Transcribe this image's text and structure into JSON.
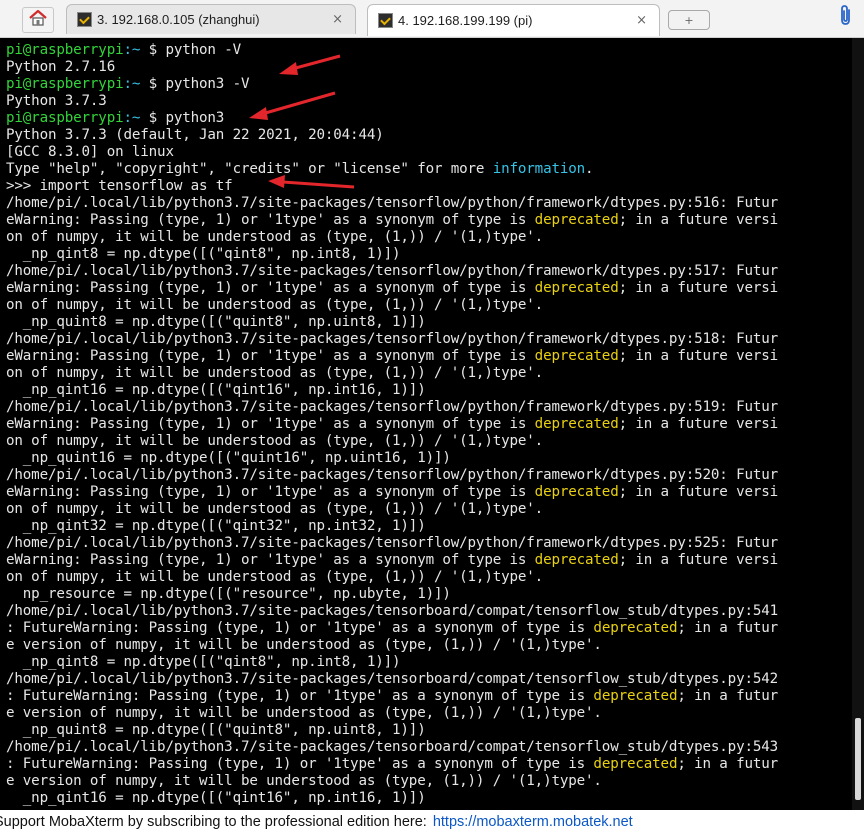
{
  "tabs": [
    {
      "label": "3. 192.168.0.105 (zhanghui)",
      "close": "×",
      "icon": "terminal-icon"
    },
    {
      "label": "4. 192.168.199.199 (pi)",
      "close": "×",
      "icon": "terminal-icon"
    }
  ],
  "newtab_label": "+",
  "icons": {
    "home": "home-icon",
    "attach": "paperclip-icon"
  },
  "colors": {
    "prompt": "#32d43a",
    "path_sep": "#36c3e6",
    "highlight": "#e8d10e",
    "text": "#e6e6e6",
    "background": "#000000",
    "arrow": "#e3262b"
  },
  "terminal_lines": [
    [
      {
        "t": "pi@raspberrypi",
        "c": "g"
      },
      {
        "t": ":~ ",
        "c": "c"
      },
      {
        "t": "$ python -V"
      }
    ],
    [
      {
        "t": "Python 2.7.16"
      }
    ],
    [
      {
        "t": "pi@raspberrypi",
        "c": "g"
      },
      {
        "t": ":~ ",
        "c": "c"
      },
      {
        "t": "$ python3 -V"
      }
    ],
    [
      {
        "t": "Python 3.7.3"
      }
    ],
    [
      {
        "t": "pi@raspberrypi",
        "c": "g"
      },
      {
        "t": ":~ ",
        "c": "c"
      },
      {
        "t": "$ python3"
      }
    ],
    [
      {
        "t": "Python 3.7.3 (default, Jan 22 2021, 20:04:44)"
      }
    ],
    [
      {
        "t": "[GCC 8.3.0] on linux"
      }
    ],
    [
      {
        "t": "Type \"help\", \"copyright\", \"credits\" or \"license\" for more "
      },
      {
        "t": "information",
        "c": "c"
      },
      {
        "t": "."
      }
    ],
    [
      {
        "t": ">>> import tensorflow as tf"
      }
    ],
    [
      {
        "t": "/home/pi/.local/lib/python3.7/site-packages/tensorflow/python/framework/dtypes.py:516: Futur"
      }
    ],
    [
      {
        "t": "eWarning: Passing (type, 1) or '1type' as a synonym of type is "
      },
      {
        "t": "deprecated",
        "c": "y"
      },
      {
        "t": "; in a future versi"
      }
    ],
    [
      {
        "t": "on of numpy, it will be understood as (type, (1,)) / '(1,)type'."
      }
    ],
    [
      {
        "t": "  _np_qint8 = np.dtype([(\"qint8\", np.int8, 1)])"
      }
    ],
    [
      {
        "t": "/home/pi/.local/lib/python3.7/site-packages/tensorflow/python/framework/dtypes.py:517: Futur"
      }
    ],
    [
      {
        "t": "eWarning: Passing (type, 1) or '1type' as a synonym of type is "
      },
      {
        "t": "deprecated",
        "c": "y"
      },
      {
        "t": "; in a future versi"
      }
    ],
    [
      {
        "t": "on of numpy, it will be understood as (type, (1,)) / '(1,)type'."
      }
    ],
    [
      {
        "t": "  _np_quint8 = np.dtype([(\"quint8\", np.uint8, 1)])"
      }
    ],
    [
      {
        "t": "/home/pi/.local/lib/python3.7/site-packages/tensorflow/python/framework/dtypes.py:518: Futur"
      }
    ],
    [
      {
        "t": "eWarning: Passing (type, 1) or '1type' as a synonym of type is "
      },
      {
        "t": "deprecated",
        "c": "y"
      },
      {
        "t": "; in a future versi"
      }
    ],
    [
      {
        "t": "on of numpy, it will be understood as (type, (1,)) / '(1,)type'."
      }
    ],
    [
      {
        "t": "  _np_qint16 = np.dtype([(\"qint16\", np.int16, 1)])"
      }
    ],
    [
      {
        "t": "/home/pi/.local/lib/python3.7/site-packages/tensorflow/python/framework/dtypes.py:519: Futur"
      }
    ],
    [
      {
        "t": "eWarning: Passing (type, 1) or '1type' as a synonym of type is "
      },
      {
        "t": "deprecated",
        "c": "y"
      },
      {
        "t": "; in a future versi"
      }
    ],
    [
      {
        "t": "on of numpy, it will be understood as (type, (1,)) / '(1,)type'."
      }
    ],
    [
      {
        "t": "  _np_quint16 = np.dtype([(\"quint16\", np.uint16, 1)])"
      }
    ],
    [
      {
        "t": "/home/pi/.local/lib/python3.7/site-packages/tensorflow/python/framework/dtypes.py:520: Futur"
      }
    ],
    [
      {
        "t": "eWarning: Passing (type, 1) or '1type' as a synonym of type is "
      },
      {
        "t": "deprecated",
        "c": "y"
      },
      {
        "t": "; in a future versi"
      }
    ],
    [
      {
        "t": "on of numpy, it will be understood as (type, (1,)) / '(1,)type'."
      }
    ],
    [
      {
        "t": "  _np_qint32 = np.dtype([(\"qint32\", np.int32, 1)])"
      }
    ],
    [
      {
        "t": "/home/pi/.local/lib/python3.7/site-packages/tensorflow/python/framework/dtypes.py:525: Futur"
      }
    ],
    [
      {
        "t": "eWarning: Passing (type, 1) or '1type' as a synonym of type is "
      },
      {
        "t": "deprecated",
        "c": "y"
      },
      {
        "t": "; in a future versi"
      }
    ],
    [
      {
        "t": "on of numpy, it will be understood as (type, (1,)) / '(1,)type'."
      }
    ],
    [
      {
        "t": "  np_resource = np.dtype([(\"resource\", np.ubyte, 1)])"
      }
    ],
    [
      {
        "t": "/home/pi/.local/lib/python3.7/site-packages/tensorboard/compat/tensorflow_stub/dtypes.py:541"
      }
    ],
    [
      {
        "t": ": FutureWarning: Passing (type, 1) or '1type' as a synonym of type is "
      },
      {
        "t": "deprecated",
        "c": "y"
      },
      {
        "t": "; in a futur"
      }
    ],
    [
      {
        "t": "e version of numpy, it will be understood as (type, (1,)) / '(1,)type'."
      }
    ],
    [
      {
        "t": "  _np_qint8 = np.dtype([(\"qint8\", np.int8, 1)])"
      }
    ],
    [
      {
        "t": "/home/pi/.local/lib/python3.7/site-packages/tensorboard/compat/tensorflow_stub/dtypes.py:542"
      }
    ],
    [
      {
        "t": ": FutureWarning: Passing (type, 1) or '1type' as a synonym of type is "
      },
      {
        "t": "deprecated",
        "c": "y"
      },
      {
        "t": "; in a futur"
      }
    ],
    [
      {
        "t": "e version of numpy, it will be understood as (type, (1,)) / '(1,)type'."
      }
    ],
    [
      {
        "t": "  _np_quint8 = np.dtype([(\"quint8\", np.uint8, 1)])"
      }
    ],
    [
      {
        "t": "/home/pi/.local/lib/python3.7/site-packages/tensorboard/compat/tensorflow_stub/dtypes.py:543"
      }
    ],
    [
      {
        "t": ": FutureWarning: Passing (type, 1) or '1type' as a synonym of type is "
      },
      {
        "t": "deprecated",
        "c": "y"
      },
      {
        "t": "; in a futur"
      }
    ],
    [
      {
        "t": "e version of numpy, it will be understood as (type, (1,)) / '(1,)type'."
      }
    ],
    [
      {
        "t": "  _np_qint16 = np.dtype([(\"qint16\", np.int16, 1)])"
      }
    ]
  ],
  "status_bar": {
    "text": "Support MobaXterm by subscribing to the professional edition here:",
    "link": "https://mobaxterm.mobatek.net"
  }
}
